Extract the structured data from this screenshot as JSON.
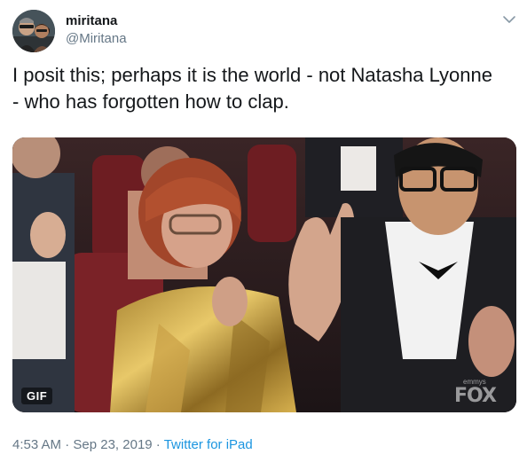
{
  "user": {
    "display_name": "miritana",
    "handle": "@Miritana"
  },
  "tweet": {
    "text": "I posit this; perhaps it is the world - not Natasha Lyonne\n- who has forgotten how to clap."
  },
  "media": {
    "badge": "GIF",
    "watermark_small": "emmys",
    "watermark": "FOX",
    "description_icon": "gif-media"
  },
  "meta": {
    "time": "4:53 AM",
    "separator": " · ",
    "date": "Sep 23, 2019",
    "source": "Twitter for iPad"
  },
  "colors": {
    "text_primary": "#14171a",
    "text_secondary": "#657786",
    "link": "#1b95e0"
  },
  "icons": {
    "menu": "chevron-down-icon"
  }
}
